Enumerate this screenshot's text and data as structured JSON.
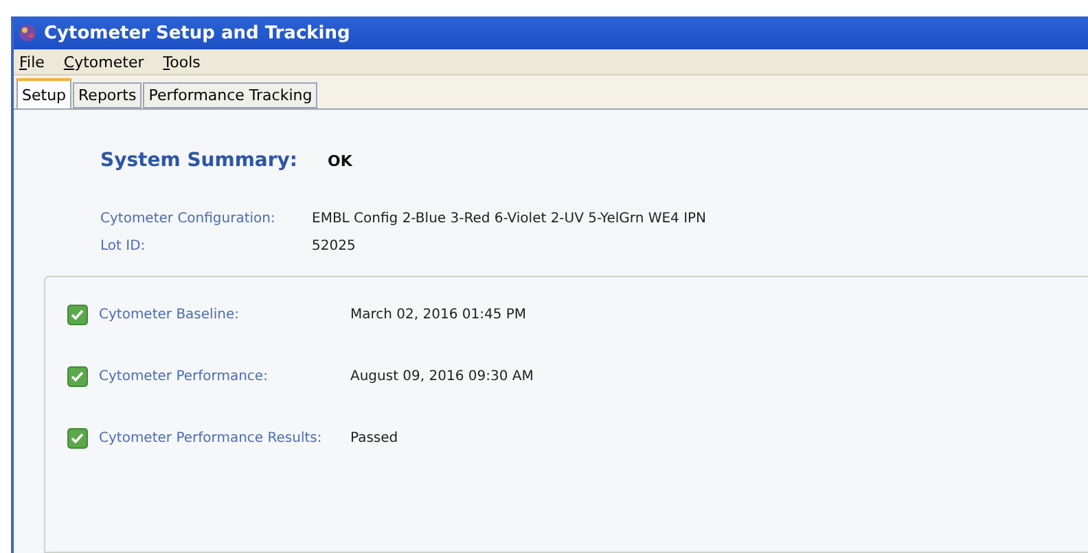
{
  "window": {
    "title": "Cytometer Setup and Tracking"
  },
  "menu": [
    "File",
    "Cytometer",
    "Tools"
  ],
  "tabs": [
    {
      "label": "Setup",
      "selected": true
    },
    {
      "label": "Reports",
      "selected": false
    },
    {
      "label": "Performance Tracking",
      "selected": false
    }
  ],
  "summary": {
    "label": "System Summary:",
    "value": "OK"
  },
  "info": [
    {
      "label": "Cytometer Configuration:",
      "value": "EMBL Config 2-Blue 3-Red 6-Violet 2-UV 5-YelGrn WE4 IPN"
    },
    {
      "label": "Lot ID:",
      "value": "52025"
    }
  ],
  "checks": [
    {
      "label": "Cytometer Baseline:",
      "value": "March 02, 2016 01:45 PM",
      "checked": true
    },
    {
      "label": "Cytometer Performance:",
      "value": "August 09, 2016 09:30 AM",
      "checked": true
    },
    {
      "label": "Cytometer Performance Results:",
      "value": "Passed",
      "checked": true
    }
  ]
}
